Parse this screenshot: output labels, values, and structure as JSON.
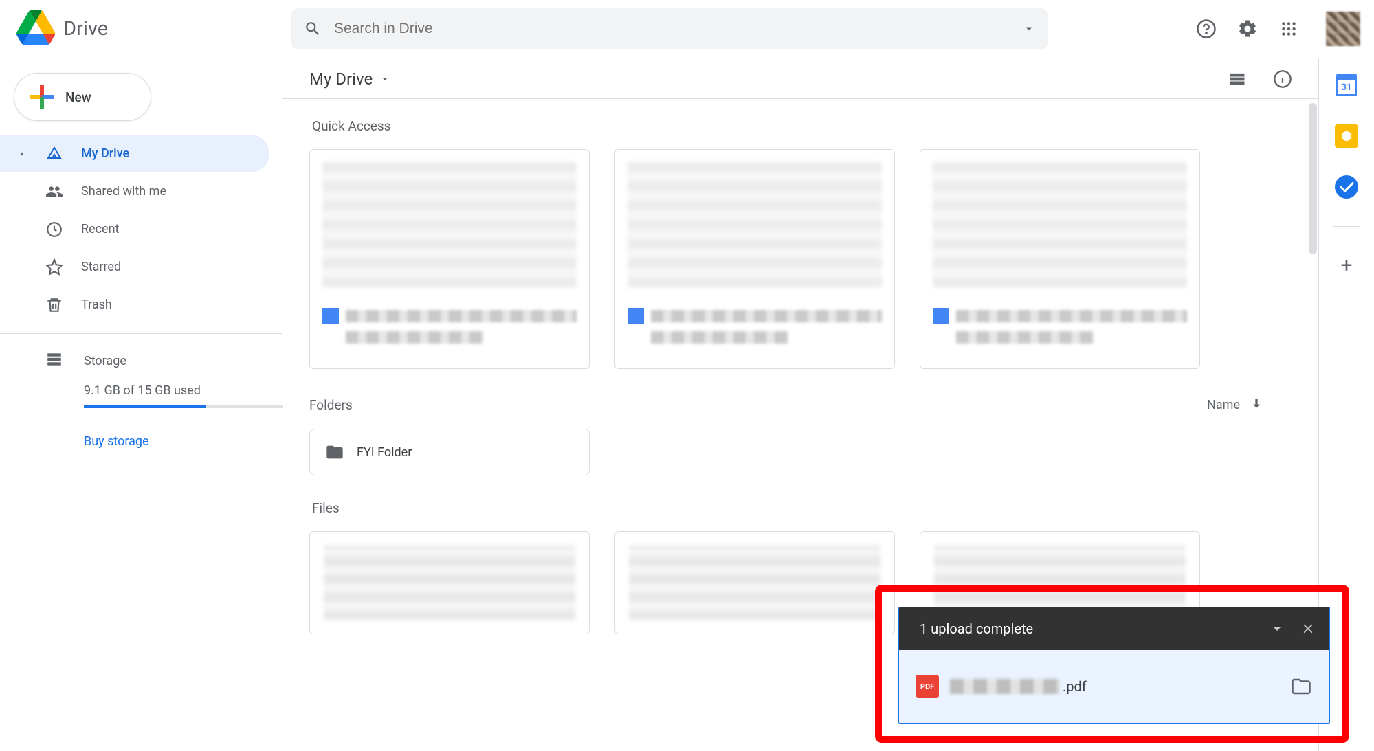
{
  "header": {
    "product": "Drive",
    "search_placeholder": "Search in Drive"
  },
  "sidebar": {
    "new_label": "New",
    "items": [
      {
        "label": "My Drive"
      },
      {
        "label": "Shared with me"
      },
      {
        "label": "Recent"
      },
      {
        "label": "Starred"
      },
      {
        "label": "Trash"
      }
    ],
    "storage_label": "Storage",
    "storage_used_text": "9.1 GB of 15 GB used",
    "storage_percent": 61,
    "buy_label": "Buy storage"
  },
  "main": {
    "breadcrumb": "My Drive",
    "quick_access_label": "Quick Access",
    "folders_label": "Folders",
    "sort_label": "Name",
    "folders": [
      {
        "name": "FYI Folder"
      }
    ],
    "files_label": "Files"
  },
  "sidepanel": {
    "calendar_day": "31"
  },
  "toast": {
    "title": "1 upload complete",
    "file_ext": ".pdf",
    "pdf_badge": "PDF"
  }
}
